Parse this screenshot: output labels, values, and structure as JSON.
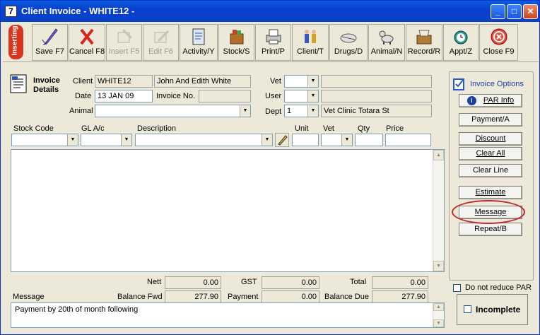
{
  "window": {
    "title": "Client Invoice - WHITE12 -",
    "app_icon": "7",
    "min": "_",
    "max": "□",
    "close": "✕"
  },
  "mode_badge": "Inserting",
  "toolbar": [
    {
      "label": "Save F7",
      "icon": "pen-check-icon",
      "enabled": true
    },
    {
      "label": "Cancel F8",
      "icon": "red-x-icon",
      "enabled": true
    },
    {
      "label": "Insert F5",
      "icon": "insert-icon",
      "enabled": false
    },
    {
      "label": "Edit F6",
      "icon": "edit-icon",
      "enabled": false
    },
    {
      "label": "Activity/Y",
      "icon": "activity-icon",
      "enabled": true
    },
    {
      "label": "Stock/S",
      "icon": "stock-box-icon",
      "enabled": true
    },
    {
      "label": "Print/P",
      "icon": "printer-icon",
      "enabled": true
    },
    {
      "label": "Client/T",
      "icon": "client-people-icon",
      "enabled": true
    },
    {
      "label": "Drugs/D",
      "icon": "drugs-icon",
      "enabled": true
    },
    {
      "label": "Animal/N",
      "icon": "dog-icon",
      "enabled": true
    },
    {
      "label": "Record/R",
      "icon": "record-cards-icon",
      "enabled": true
    },
    {
      "label": "Appt/Z",
      "icon": "alarm-clock-icon",
      "enabled": true
    },
    {
      "label": "Close F9",
      "icon": "close-circle-icon",
      "enabled": true
    }
  ],
  "details": {
    "heading1": "Invoice",
    "heading2": "Details",
    "client_label": "Client",
    "client_code": "WHITE12",
    "client_name": "John And Edith White",
    "date_label": "Date",
    "date_value": "13 JAN 09",
    "invoice_no_label": "Invoice No.",
    "invoice_no_value": "",
    "animal_label": "Animal",
    "animal_value": "",
    "vet_label": "Vet",
    "user_label": "User",
    "dept_label": "Dept",
    "dept_value": "1",
    "dept_name": "Vet Clinic Totara St"
  },
  "columns": {
    "stock_code": "Stock Code",
    "gl": "GL A/c",
    "description": "Description",
    "unit": "Unit",
    "vet": "Vet",
    "qty": "Qty",
    "price": "Price"
  },
  "totals": {
    "nett_label": "Nett",
    "nett": "0.00",
    "gst_label": "GST",
    "gst": "0.00",
    "total_label": "Total",
    "total": "0.00",
    "balance_fwd_label": "Balance Fwd",
    "balance_fwd": "277.90",
    "payment_label": "Payment",
    "payment": "0.00",
    "balance_due_label": "Balance Due",
    "balance_due": "277.90"
  },
  "message": {
    "label": "Message",
    "text": "Payment by 20th of month following"
  },
  "options": {
    "title": "Invoice Options",
    "par_info": "PAR Info",
    "payment": "Payment/A",
    "discount": "Discount",
    "clear_all": "Clear All",
    "clear_line": "Clear Line",
    "estimate": "Estimate",
    "message": "Message",
    "repeat": "Repeat/B",
    "do_not_reduce_par": "Do not reduce PAR",
    "incomplete": "Incomplete"
  }
}
